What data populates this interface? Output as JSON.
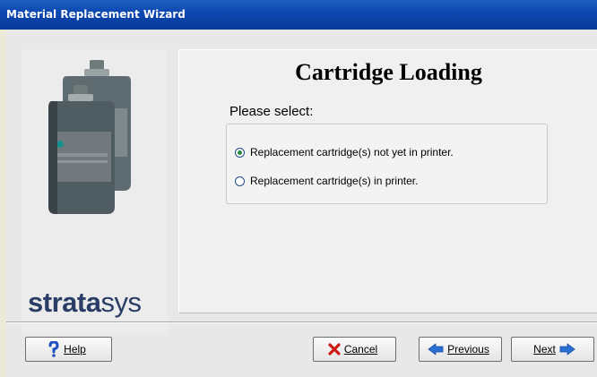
{
  "window": {
    "title": "Material Replacement Wizard"
  },
  "brand": {
    "name_bold": "strata",
    "name_light": "sys"
  },
  "panel": {
    "title": "Cartridge Loading",
    "prompt": "Please select:",
    "options": [
      {
        "label": "Replacement cartridge(s) not yet in printer.",
        "selected": true
      },
      {
        "label": "Replacement cartridge(s) in printer.",
        "selected": false
      }
    ]
  },
  "buttons": {
    "help": "Help",
    "cancel": "Cancel",
    "previous": "Previous",
    "next": "Next"
  },
  "icons": {
    "help": "question-mark-icon",
    "cancel": "red-x-icon",
    "previous": "left-arrow-icon",
    "next": "right-arrow-icon"
  },
  "colors": {
    "titlebar": "#0b46b0",
    "brand_text": "#2a3d66",
    "radio_selected": "#2a8a3c"
  }
}
